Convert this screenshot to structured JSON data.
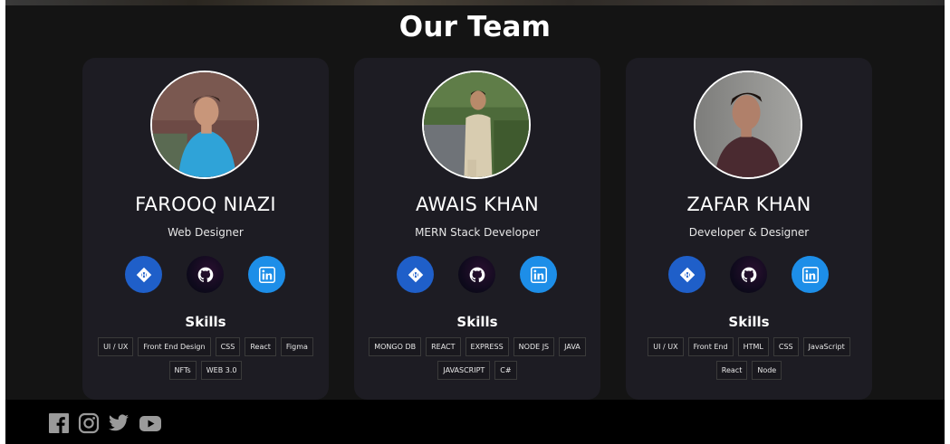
{
  "page": {
    "title": "Our Team",
    "skills_heading": "Skills"
  },
  "team": [
    {
      "name": "FAROOQ NIAZI",
      "role": "Web Designer",
      "skills": [
        "UI / UX",
        "Front End Design",
        "CSS",
        "React",
        "Figma",
        "NFTs",
        "WEB 3.0"
      ]
    },
    {
      "name": "AWAIS KHAN",
      "role": "MERN Stack Developer",
      "skills": [
        "MONGO DB",
        "REACT",
        "EXPRESS",
        "NODE JS",
        "JAVA",
        "JAVASCRIPT",
        "C#"
      ]
    },
    {
      "name": "ZAFAR KHAN",
      "role": "Developer & Designer",
      "skills": [
        "UI / UX",
        "Front End",
        "HTML",
        "CSS",
        "JavaScript",
        "React",
        "Node"
      ]
    }
  ],
  "social_icons": [
    "hashnode-icon",
    "github-icon",
    "linkedin-icon"
  ],
  "footer_icons": [
    "facebook-icon",
    "instagram-icon",
    "twitter-icon",
    "youtube-icon"
  ],
  "colors": {
    "background": "#141414",
    "card": "#1d1c23",
    "hashnode": "#1f5fc9",
    "linkedin": "#1d8ee8",
    "footer": "#000000",
    "footer_icon": "#9a9a9a"
  }
}
